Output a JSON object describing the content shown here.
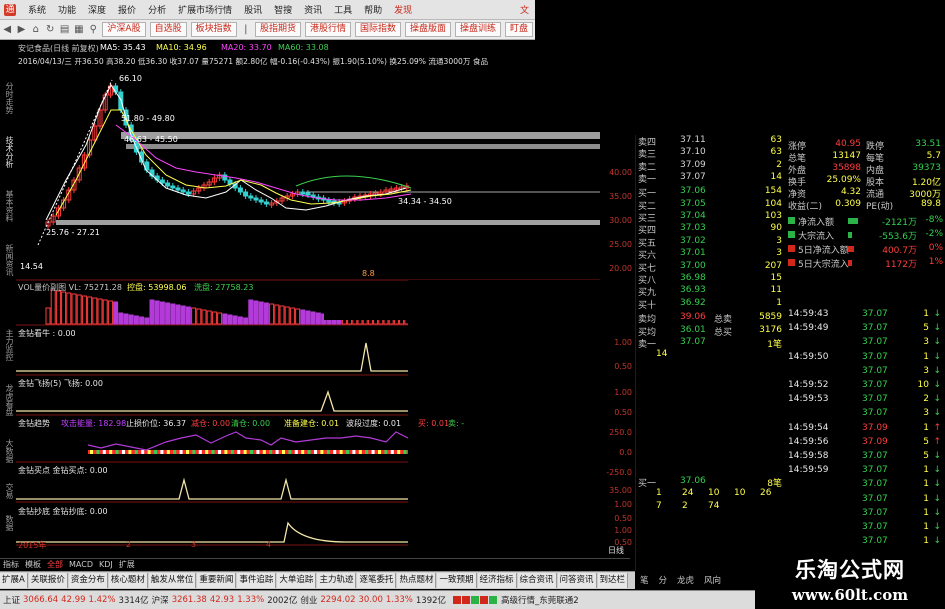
{
  "menu": {
    "items": [
      "系统",
      "功能",
      "深度",
      "报价",
      "分析",
      "扩展市场行情",
      "股讯",
      "智搜",
      "资讯",
      "工具",
      "帮助"
    ],
    "highlight": "发现",
    "right_label": "文"
  },
  "toolbar": {
    "buttons": [
      "沪深A股",
      "自选股",
      "板块指数",
      "股指期货",
      "港股行情",
      "国际指数",
      "操盘版面",
      "操盘训练",
      "盯盘"
    ]
  },
  "left_tabs": [
    "分时走势",
    "技术分析",
    "基本资料",
    "新闻资讯",
    "主力监控",
    "龙虎看盘",
    "大数据",
    "交易",
    "数据"
  ],
  "chart": {
    "title_line": {
      "name": "安记食品(日线 前复权)",
      "ma5": "MA5: 35.43",
      "ma10": "MA10: 34.96",
      "ma20": "MA20: 33.70",
      "ma60": "MA60: 33.08"
    },
    "info_line": "2016/04/13/三 开36.50 高38.20 低36.30 收37.07 量75271 额2.80亿 幅-0.16(-0.43%) 振1.90(5.10%) 换25.09% 流通3000万 食品",
    "annotations": [
      "66.10",
      "51.80 - 49.80",
      "46.63 - 45.50",
      "34.34 - 34.50",
      "25.76 - 27.21",
      "14.54"
    ],
    "price_ticks": [
      "40.00",
      "35.00",
      "30.00",
      "25.00",
      "20.00"
    ],
    "vol_label": "VOL量价副图 VL: 75271.28",
    "vol_control": "控盘: 53998.06",
    "vol_wash": "洗盘: 27758.23",
    "ind1": "金钻看牛 : 0.00",
    "ind2": "金钻飞扬(5) 飞扬: 0.00",
    "ind3": "金钻趋势",
    "ind3_a": "攻击能量: 182.98",
    "ind3_b": "止损价位: 36.37",
    "ind3_c": "减仓: 0.00",
    "ind3_d": "清仓: 0.00",
    "ind3_e": "准备建仓: 0.01",
    "ind3_f": "波段过度: 0.01",
    "ind3_buy": "买: 0.01",
    "ind3_sell": "卖: -",
    "ind4": "金钻买点 金钻买点: 0.00",
    "ind5": "金钻抄底 金钻抄底: 0.00",
    "ind_ticks": [
      "1.00",
      "0.50",
      "1.00",
      "0.50",
      "250.0",
      "0.0",
      "-250.0",
      "35.00",
      "1.00",
      "0.50",
      "1.00",
      "0.50"
    ],
    "xaxis": [
      "2015年",
      "2",
      "3",
      "4"
    ],
    "date_label": "日线",
    "mark_label": "8.8"
  },
  "book": {
    "asks": [
      [
        "卖四",
        "37.11",
        "63"
      ],
      [
        "卖三",
        "37.10",
        "63"
      ],
      [
        "卖二",
        "37.09",
        "2"
      ],
      [
        "卖一",
        "37.07",
        "14"
      ]
    ],
    "bids": [
      [
        "买一",
        "37.06",
        "154"
      ],
      [
        "买二",
        "37.05",
        "104"
      ],
      [
        "买三",
        "37.04",
        "103"
      ],
      [
        "买四",
        "37.03",
        "90"
      ],
      [
        "买五",
        "37.02",
        "3"
      ],
      [
        "买六",
        "37.01",
        "3"
      ],
      [
        "买七",
        "37.00",
        "207"
      ],
      [
        "买八",
        "36.98",
        "15"
      ],
      [
        "买九",
        "36.93",
        "11"
      ],
      [
        "买十",
        "36.92",
        "1"
      ]
    ],
    "avg_sell": [
      "卖均",
      "39.06",
      "总卖",
      "5859"
    ],
    "avg_buy": [
      "买均",
      "36.01",
      "总买",
      "3176"
    ],
    "sell1_detail": [
      "卖一",
      "37.07",
      "1笔"
    ],
    "sell1_qty": "14",
    "buy1_detail": [
      "买一",
      "37.06",
      "8笔"
    ],
    "buy1_qtys": [
      [
        "1",
        "24",
        "10",
        "10",
        "26"
      ],
      [
        "7",
        "2",
        "74",
        "",
        ""
      ]
    ]
  },
  "stats": {
    "rows": [
      [
        "涨停",
        "40.95",
        "跌停",
        "33.51"
      ],
      [
        "总笔",
        "13147",
        "每笔",
        "5.7"
      ],
      [
        "外盘",
        "35898",
        "内盘",
        "39373"
      ],
      [
        "换手",
        "25.09%",
        "股本",
        "1.20亿"
      ],
      [
        "净资",
        "4.32",
        "流通",
        "3000万"
      ],
      [
        "收益(二)",
        "0.309",
        "PE(动)",
        "89.8"
      ]
    ],
    "flows": [
      [
        "净流入额",
        "-2121万",
        "-8%"
      ],
      [
        "大宗流入",
        "-553.6万",
        "-2%"
      ],
      [
        "5日净流入额",
        "400.7万",
        "0%"
      ],
      [
        "5日大宗流入",
        "1172万",
        "1%"
      ]
    ]
  },
  "ticks": {
    "rows": [
      [
        "14:59:43",
        "37.07",
        "1",
        "S"
      ],
      [
        "14:59:49",
        "37.07",
        "5",
        "S"
      ],
      [
        "",
        "37.07",
        "3",
        "S"
      ],
      [
        "14:59:50",
        "37.07",
        "1",
        "S"
      ],
      [
        "",
        "37.07",
        "3",
        "S"
      ],
      [
        "14:59:52",
        "37.07",
        "10",
        "S"
      ],
      [
        "14:59:53",
        "37.07",
        "2",
        "S"
      ],
      [
        "",
        "37.07",
        "3",
        "S"
      ],
      [
        "14:59:54",
        "37.09",
        "1",
        "B"
      ],
      [
        "14:59:56",
        "37.09",
        "5",
        "B"
      ],
      [
        "14:59:58",
        "37.07",
        "5",
        "S"
      ],
      [
        "14:59:59",
        "37.07",
        "1",
        "S"
      ],
      [
        "",
        "37.07",
        "1",
        "S"
      ],
      [
        "",
        "37.07",
        "1",
        "S"
      ],
      [
        "",
        "37.07",
        "1",
        "S"
      ],
      [
        "",
        "37.07",
        "1",
        "S"
      ],
      [
        "",
        "37.07",
        "1",
        "S"
      ],
      [
        "",
        "37.07",
        "1",
        "S"
      ]
    ]
  },
  "indicator_tabs": [
    "指标",
    "模板",
    "全部",
    "MACD",
    "KDJ",
    "扩展"
  ],
  "bottom_tabs": [
    "扩展A",
    "关联报价",
    "资金分布",
    "核心题材",
    "触发从常位",
    "重要新闻",
    "事件追踪",
    "大单追踪",
    "主力轨迹",
    "逐笔委托",
    "热点题材",
    "一致预期",
    "经济指标",
    "综合资讯",
    "问答资讯",
    "到达栏"
  ],
  "right_tabs": [
    "笔",
    "分",
    "龙虎",
    "风向"
  ],
  "status": {
    "sh_label": "上证",
    "sh_val": "3066.64",
    "sh_chg": "42.99",
    "sh_pct": "1.42%",
    "sh_amt": "3314亿",
    "hs_label": "沪深",
    "hs_val": "3261.38",
    "hs_chg": "42.93",
    "hs_pct": "1.33%",
    "hs_amt": "2002亿",
    "cy_label": "创业",
    "cy_val": "2294.02",
    "cy_chg": "30.00",
    "cy_pct": "1.33%",
    "cy_amt": "1392亿",
    "right_text": "高级行情_东莞联通2"
  },
  "watermark": {
    "title": "乐淘公式网",
    "url": "www.60lt.com"
  },
  "colors": {
    "up": "#ff3d3d",
    "down": "#35d14e",
    "price": "#ffff4a",
    "ask": "#d4d4d4"
  }
}
